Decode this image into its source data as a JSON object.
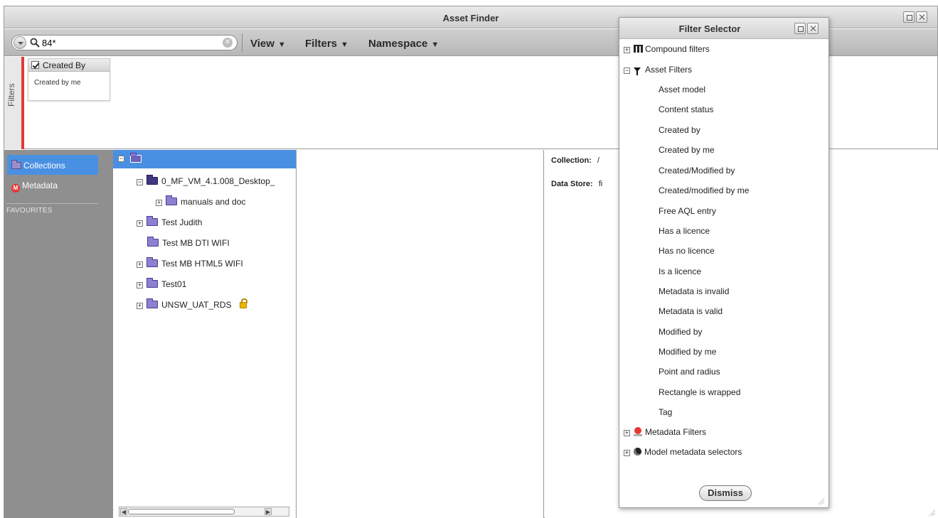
{
  "window": {
    "title": "Asset Finder"
  },
  "toolbar": {
    "search_value": "84*",
    "menus": [
      {
        "label": "View"
      },
      {
        "label": "Filters"
      },
      {
        "label": "Namespace"
      }
    ]
  },
  "filters_strip": {
    "tab_label": "Filters",
    "card": {
      "header": "Created By",
      "body": "Created by me"
    }
  },
  "sidebar": {
    "items": [
      {
        "label": "Collections",
        "active": true,
        "icon": "folder-icon"
      },
      {
        "label": "Metadata",
        "active": false,
        "icon": "metadata-icon"
      }
    ],
    "section_label": "FAVOURITES"
  },
  "tree": {
    "items": [
      {
        "label": "0_MF_VM_4.1.008_Desktop_",
        "expander": "minus",
        "folder": "dark"
      },
      {
        "label": "manuals and doc",
        "expander": "plus",
        "folder": "normal"
      },
      {
        "label": "Test Judith",
        "expander": "plus",
        "folder": "normal"
      },
      {
        "label": "Test MB DTI WIFI",
        "expander": "none",
        "folder": "normal"
      },
      {
        "label": "Test MB HTML5 WIFI",
        "expander": "plus",
        "folder": "normal"
      },
      {
        "label": "Test01",
        "expander": "plus",
        "folder": "normal"
      },
      {
        "label": "UNSW_UAT_RDS",
        "expander": "plus",
        "folder": "normal",
        "locked": true
      }
    ]
  },
  "details": {
    "collection_label": "Collection:",
    "collection_value": "/",
    "datastore_label": "Data Store:",
    "datastore_value": "fi"
  },
  "filter_selector": {
    "title": "Filter Selector",
    "groups": {
      "compound": "Compound filters",
      "asset": "Asset Filters",
      "metadata": "Metadata Filters",
      "model": "Model metadata selectors"
    },
    "asset_filters": [
      "Asset model",
      "Content status",
      "Created by",
      "Created by me",
      "Created/Modified by",
      "Created/modified by me",
      "Free AQL entry",
      "Has a licence",
      "Has no licence",
      "Is a licence",
      "Metadata is invalid",
      "Metadata is valid",
      "Modified by",
      "Modified by me",
      "Point and radius",
      "Rectangle is wrapped",
      "Tag"
    ],
    "dismiss_label": "Dismiss"
  },
  "colors": {
    "accent_blue": "#4a90e2",
    "filter_bar_red": "#e53935",
    "sidebar_gray": "#8f8f8f"
  }
}
